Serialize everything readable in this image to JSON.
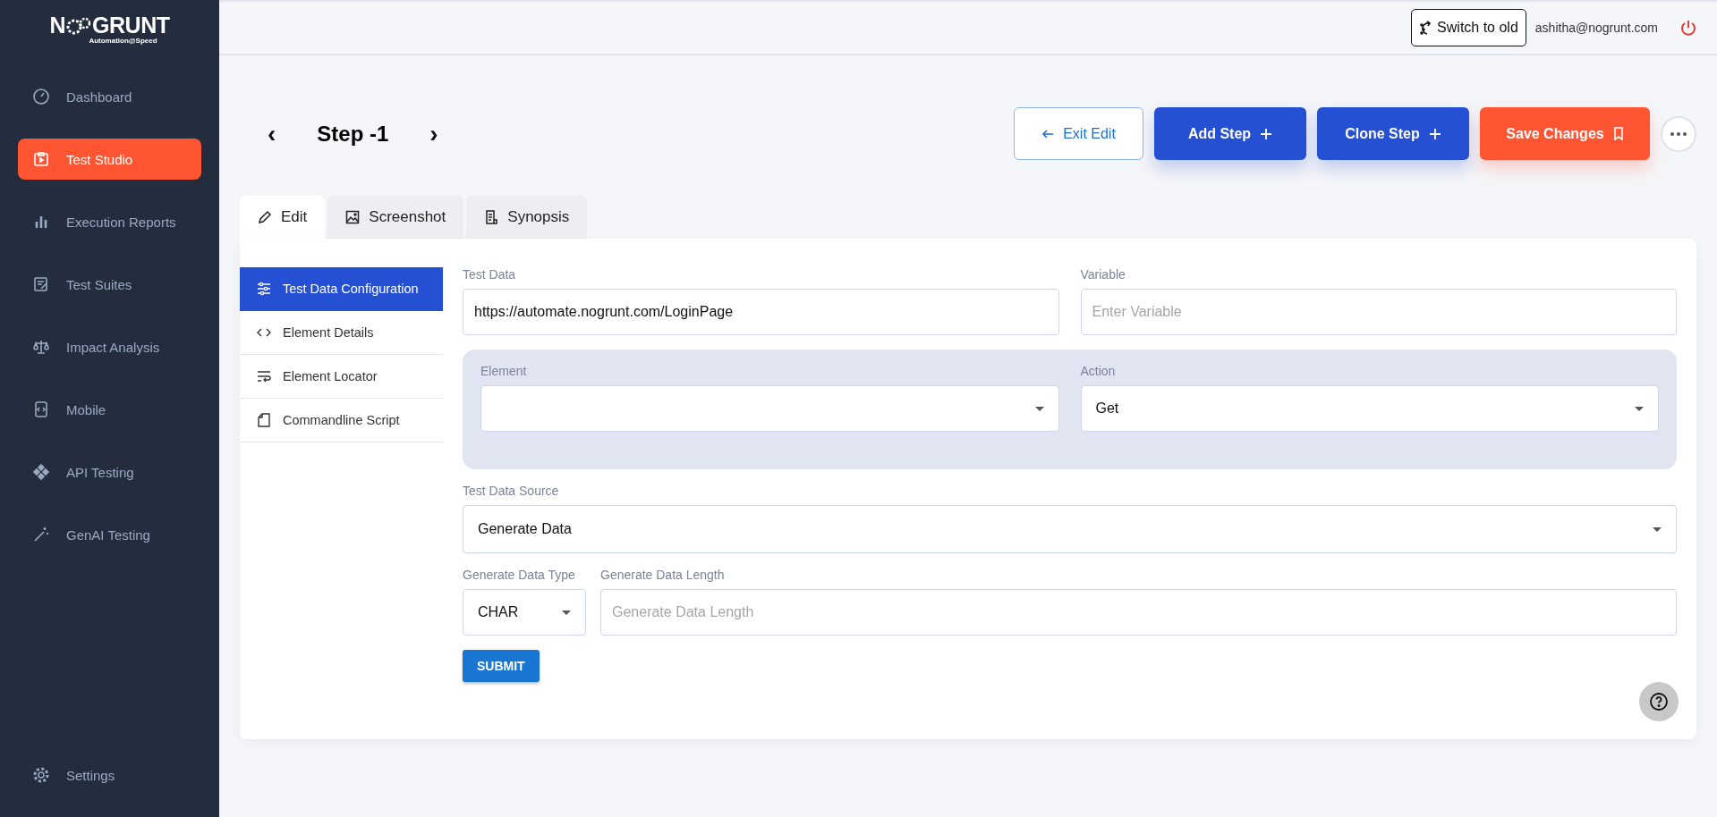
{
  "logo": {
    "name_start": "N",
    "name_end": "GRUNT",
    "tagline": "Automation@Speed"
  },
  "sidebar": {
    "items": [
      {
        "label": "Dashboard",
        "selected": false
      },
      {
        "label": "Test Studio",
        "selected": true
      },
      {
        "label": "Execution Reports",
        "selected": false
      },
      {
        "label": "Test Suites",
        "selected": false
      },
      {
        "label": "Impact Analysis",
        "selected": false
      },
      {
        "label": "Mobile",
        "selected": false
      },
      {
        "label": "API Testing",
        "selected": false
      },
      {
        "label": "GenAI Testing",
        "selected": false
      }
    ],
    "settings": "Settings"
  },
  "header": {
    "switch_button": "Switch to old",
    "user_email": "ashitha@nogrunt.com"
  },
  "step": {
    "title": "Step -1",
    "prev": "‹",
    "next": "›"
  },
  "actions": [
    {
      "kind": "outline",
      "label": "Exit Edit"
    },
    {
      "kind": "primary",
      "label": "Add Step"
    },
    {
      "kind": "primary",
      "label": "Clone Step"
    },
    {
      "kind": "accent",
      "label": "Save Changes"
    }
  ],
  "tabs": [
    {
      "label": "Edit",
      "selected": true
    },
    {
      "label": "Screenshot",
      "selected": false
    },
    {
      "label": "Synopsis",
      "selected": false
    }
  ],
  "side_menu": [
    {
      "label": "Test Data Configuration",
      "selected": true
    },
    {
      "label": "Element Details",
      "selected": false
    },
    {
      "label": "Element Locator",
      "selected": false
    },
    {
      "label": "Commandline Script",
      "selected": false
    }
  ],
  "form": {
    "test_data": {
      "label": "Test Data",
      "value": "https://automate.nogrunt.com/LoginPage"
    },
    "variable": {
      "label": "Variable",
      "placeholder": "Enter Variable"
    },
    "element": {
      "label": "Element"
    },
    "action": {
      "label": "Action",
      "value": "Get"
    },
    "test_data_source": {
      "label": "Test Data Source",
      "value": "Generate Data"
    },
    "generate_data_type": {
      "label": "Generate Data Type",
      "value": "CHAR"
    },
    "generate_data_length": {
      "label": "Generate Data Length",
      "placeholder": "Generate Data Length"
    },
    "submit": "SUBMIT"
  }
}
